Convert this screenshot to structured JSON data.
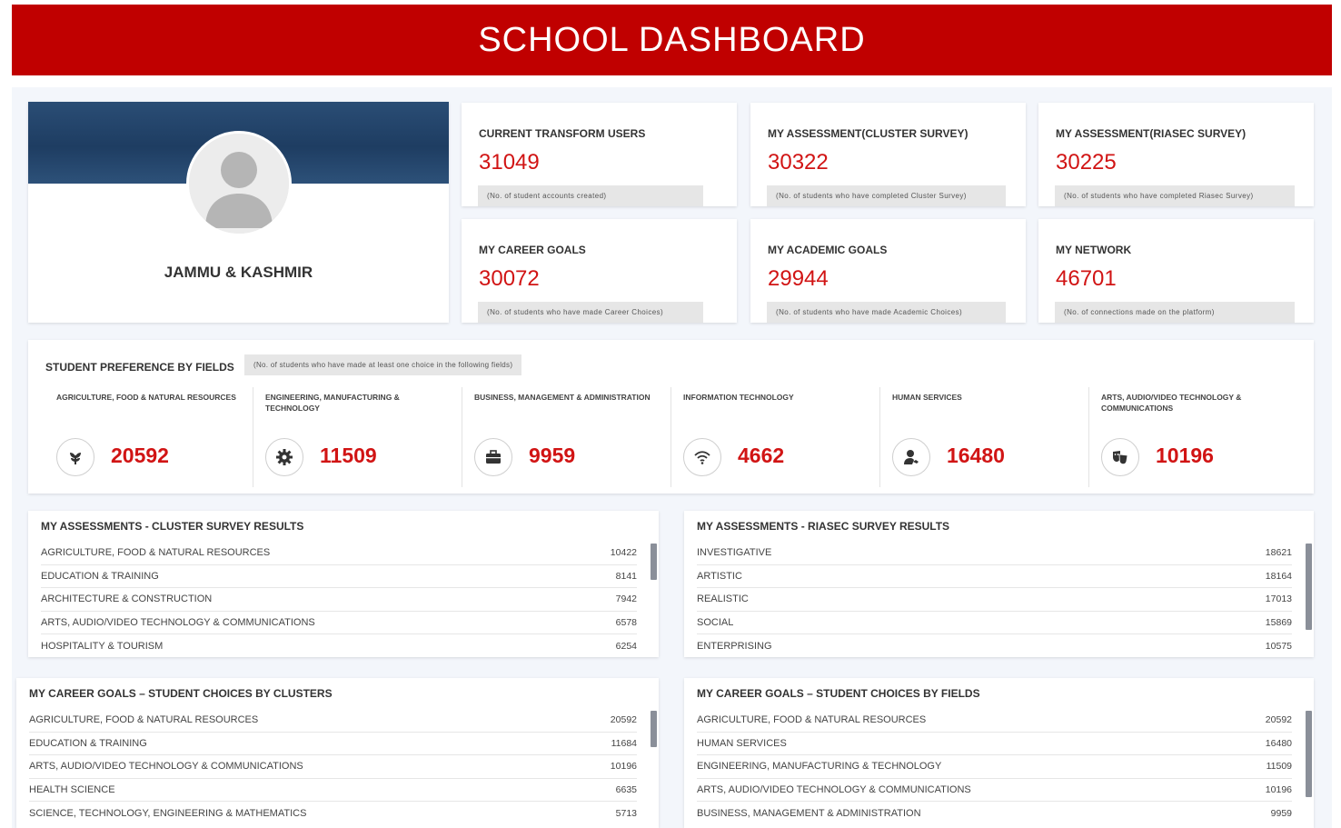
{
  "header": {
    "title": "SCHOOL DASHBOARD"
  },
  "profile": {
    "name": "JAMMU & KASHMIR"
  },
  "stats": [
    {
      "title": "CURRENT TRANSFORM USERS",
      "value": "31049",
      "note": "(No. of student accounts created)"
    },
    {
      "title": "MY ASSESSMENT(CLUSTER SURVEY)",
      "value": "30322",
      "note": "(No. of students who have completed Cluster Survey)"
    },
    {
      "title": "MY ASSESSMENT(RIASEC SURVEY)",
      "value": "30225",
      "note": "(No. of students who have completed Riasec Survey)"
    },
    {
      "title": "MY CAREER GOALS",
      "value": "30072",
      "note": "(No. of students who have made Career Choices)"
    },
    {
      "title": "MY ACADEMIC GOALS",
      "value": "29944",
      "note": "(No. of students who have made Academic Choices)"
    },
    {
      "title": "MY NETWORK",
      "value": "46701",
      "note": "(No. of connections made on the platform)"
    }
  ],
  "preferences": {
    "title": "STUDENT PREFERENCE BY FIELDS",
    "note": "(No. of students who have made at least one choice in the following fields)",
    "fields": [
      {
        "label": "AGRICULTURE, FOOD & NATURAL RESOURCES",
        "value": "20592",
        "icon": "plant-icon"
      },
      {
        "label": "ENGINEERING, MANUFACTURING & TECHNOLOGY",
        "value": "11509",
        "icon": "gear-icon"
      },
      {
        "label": "BUSINESS, MANAGEMENT & ADMINISTRATION",
        "value": "9959",
        "icon": "briefcase-icon"
      },
      {
        "label": "INFORMATION TECHNOLOGY",
        "value": "4662",
        "icon": "wifi-icon"
      },
      {
        "label": "HUMAN SERVICES",
        "value": "16480",
        "icon": "user-service-icon"
      },
      {
        "label": "ARTS, AUDIO/VIDEO TECHNOLOGY & COMMUNICATIONS",
        "value": "10196",
        "icon": "theater-masks-icon"
      }
    ]
  },
  "cluster_results": {
    "title": "MY ASSESSMENTS - CLUSTER SURVEY RESULTS",
    "rows": [
      {
        "label": "AGRICULTURE, FOOD & NATURAL RESOURCES",
        "value": "10422"
      },
      {
        "label": "EDUCATION & TRAINING",
        "value": "8141"
      },
      {
        "label": "ARCHITECTURE & CONSTRUCTION",
        "value": "7942"
      },
      {
        "label": "ARTS, AUDIO/VIDEO TECHNOLOGY & COMMUNICATIONS",
        "value": "6578"
      },
      {
        "label": "HOSPITALITY & TOURISM",
        "value": "6254"
      }
    ]
  },
  "riasec_results": {
    "title": "MY ASSESSMENTS - RIASEC SURVEY RESULTS",
    "rows": [
      {
        "label": "INVESTIGATIVE",
        "value": "18621"
      },
      {
        "label": "ARTISTIC",
        "value": "18164"
      },
      {
        "label": "REALISTIC",
        "value": "17013"
      },
      {
        "label": "SOCIAL",
        "value": "15869"
      },
      {
        "label": "ENTERPRISING",
        "value": "10575"
      }
    ]
  },
  "career_clusters": {
    "title": "MY CAREER GOALS – STUDENT CHOICES BY CLUSTERS",
    "rows": [
      {
        "label": "AGRICULTURE, FOOD & NATURAL RESOURCES",
        "value": "20592"
      },
      {
        "label": "EDUCATION & TRAINING",
        "value": "11684"
      },
      {
        "label": "ARTS, AUDIO/VIDEO TECHNOLOGY & COMMUNICATIONS",
        "value": "10196"
      },
      {
        "label": "HEALTH SCIENCE",
        "value": "6635"
      },
      {
        "label": "SCIENCE, TECHNOLOGY, ENGINEERING & MATHEMATICS",
        "value": "5713"
      }
    ]
  },
  "career_fields": {
    "title": "MY CAREER GOALS – STUDENT CHOICES BY FIELDS",
    "rows": [
      {
        "label": "AGRICULTURE, FOOD & NATURAL RESOURCES",
        "value": "20592"
      },
      {
        "label": "HUMAN SERVICES",
        "value": "16480"
      },
      {
        "label": "ENGINEERING, MANUFACTURING & TECHNOLOGY",
        "value": "11509"
      },
      {
        "label": "ARTS, AUDIO/VIDEO TECHNOLOGY & COMMUNICATIONS",
        "value": "10196"
      },
      {
        "label": "BUSINESS, MANAGEMENT & ADMINISTRATION",
        "value": "9959"
      }
    ]
  },
  "colors": {
    "brand_red": "#c00000",
    "value_red": "#d11414",
    "panel_bg": "#f3f6fb"
  }
}
